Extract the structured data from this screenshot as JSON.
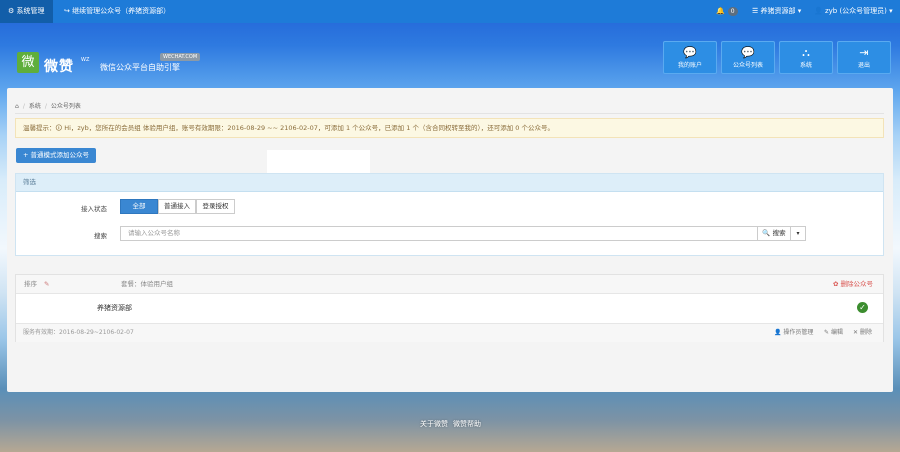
{
  "topbar": {
    "system_manage": "系统管理",
    "switch_account": "继续管理公众号（养猪资源部）",
    "notify_count": "0",
    "account_menu": "养猪资源部",
    "user_menu": "zyb (公众号管理员)"
  },
  "header": {
    "logo_char": "微",
    "logo_text": "微赞",
    "logo_small": "WZ",
    "logo_sub": "微信公众平台自助引擎",
    "logo_tag": "WECHAT.COM",
    "buttons": [
      {
        "icon": "comments-icon",
        "label": "我的账户"
      },
      {
        "icon": "comments-icon",
        "label": "公众号列表"
      },
      {
        "icon": "sitemap-icon",
        "label": "系统"
      },
      {
        "icon": "sign-out-icon",
        "label": "退出"
      }
    ]
  },
  "breadcrumb": {
    "home": "⌂",
    "system": "系统",
    "current": "公众号列表"
  },
  "alert_text": "温馨提示：🛈 Hi，zyb，您所在的会员组 体验用户组，账号有效期限：2016-08-29 ~~ 2106-02-07，可添加 1 个公众号，已添加 1 个（含合同权转至我的），还可添加 0 个公众号。",
  "add_button": "+ 普通模式添加公众号",
  "filter": {
    "title": "筛选",
    "status_label": "接入状态",
    "status_options": [
      "全部",
      "普通接入",
      "登录授权"
    ],
    "search_label": "搜索",
    "search_placeholder": "请输入公众号名称",
    "search_button": "🔍 搜索"
  },
  "list": {
    "sort_label": "排序",
    "group_label": "套餐：体验用户组",
    "delete_label": "✿ 删除公众号",
    "row_name": "养猪资源部",
    "service_period": "服务有效期：2016-08-29~2106-02-07",
    "actions": [
      "操作员管理",
      "编辑",
      "删除"
    ]
  },
  "footer": {
    "links": [
      "关于微赞",
      "微赞帮助"
    ]
  },
  "colors": {
    "accent": "#1e7bd8",
    "button": "#3a87d2",
    "danger": "#d9534f",
    "success": "#3c8d2f"
  }
}
